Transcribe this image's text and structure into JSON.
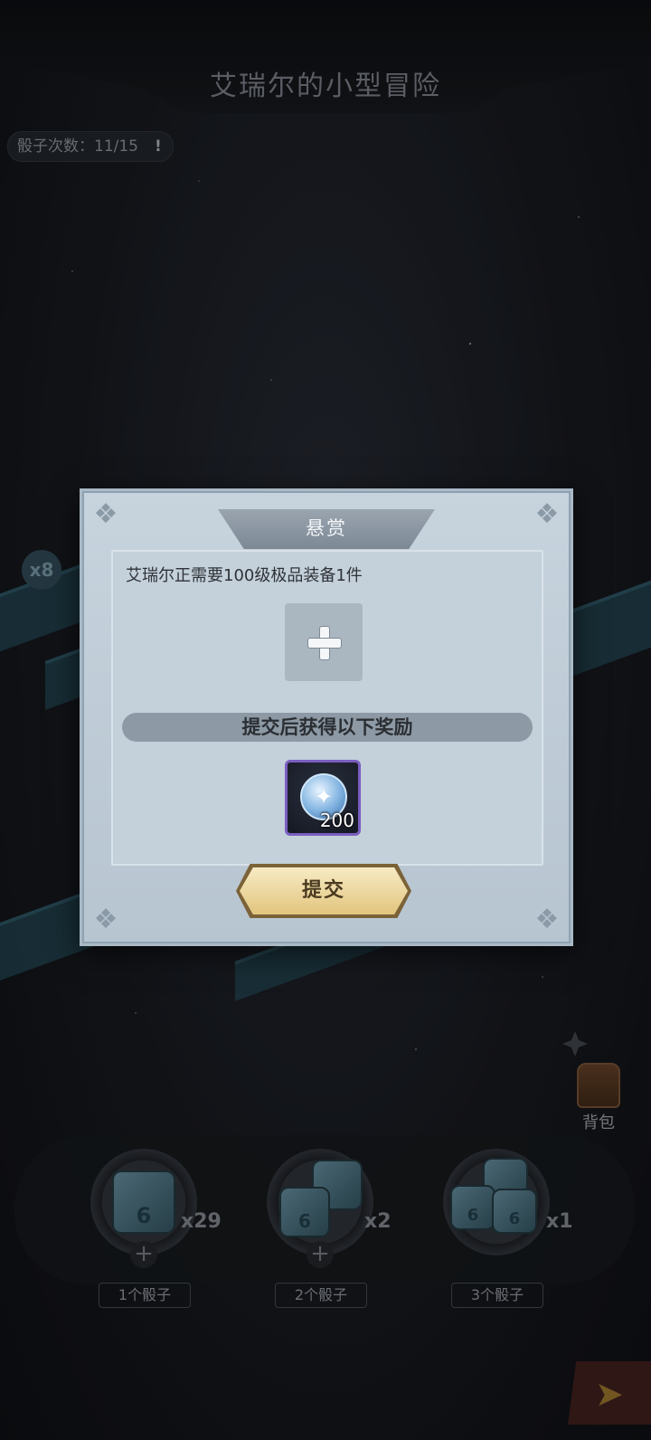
{
  "header": {
    "title": "艾瑞尔的小型冒险"
  },
  "dice_counter": {
    "label": "骰子次数：11/15",
    "warn_icon": "!"
  },
  "side": {
    "bag_label": "背包",
    "multiplier": "x8"
  },
  "dice_options": [
    {
      "label": "1个骰子",
      "qty": "x29",
      "face": "6"
    },
    {
      "label": "2个骰子",
      "qty": "x2",
      "face": "6"
    },
    {
      "label": "3个骰子",
      "qty": "x1",
      "face": "6"
    }
  ],
  "modal": {
    "title": "悬赏",
    "requirement": "艾瑞尔正需要100级极品装备1件",
    "reward_heading": "提交后获得以下奖励",
    "reward": {
      "icon": "star-coin-icon",
      "qty": "200"
    },
    "submit_label": "提交"
  },
  "colors": {
    "panel": "#c4d0da",
    "button": "#e2c57e",
    "reward_border": "#7a5ec0"
  }
}
